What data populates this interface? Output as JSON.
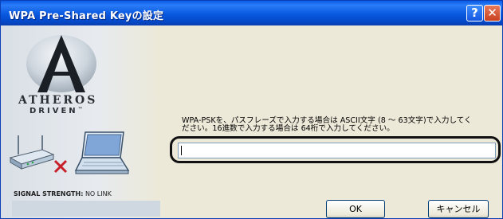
{
  "window": {
    "title": "WPA Pre-Shared Keyの設定",
    "help_label": "?",
    "close_label": "✕"
  },
  "brand": {
    "line1": "ATHEROS",
    "line2": "DRIVEN",
    "trademark": "™"
  },
  "status": {
    "signal_label": "SIGNAL STRENGTH:",
    "signal_value": "NO LINK"
  },
  "form": {
    "instruction_line1": "WPA-PSKを、パスフレーズで入力する場合は ASCII文字 (8 〜 63文字)で入力してく",
    "instruction_line2": "ださい。16進数で入力する場合は 64桁で入力してください。",
    "key_value": ""
  },
  "buttons": {
    "ok_label": "OK",
    "cancel_label": "キャンセル"
  }
}
